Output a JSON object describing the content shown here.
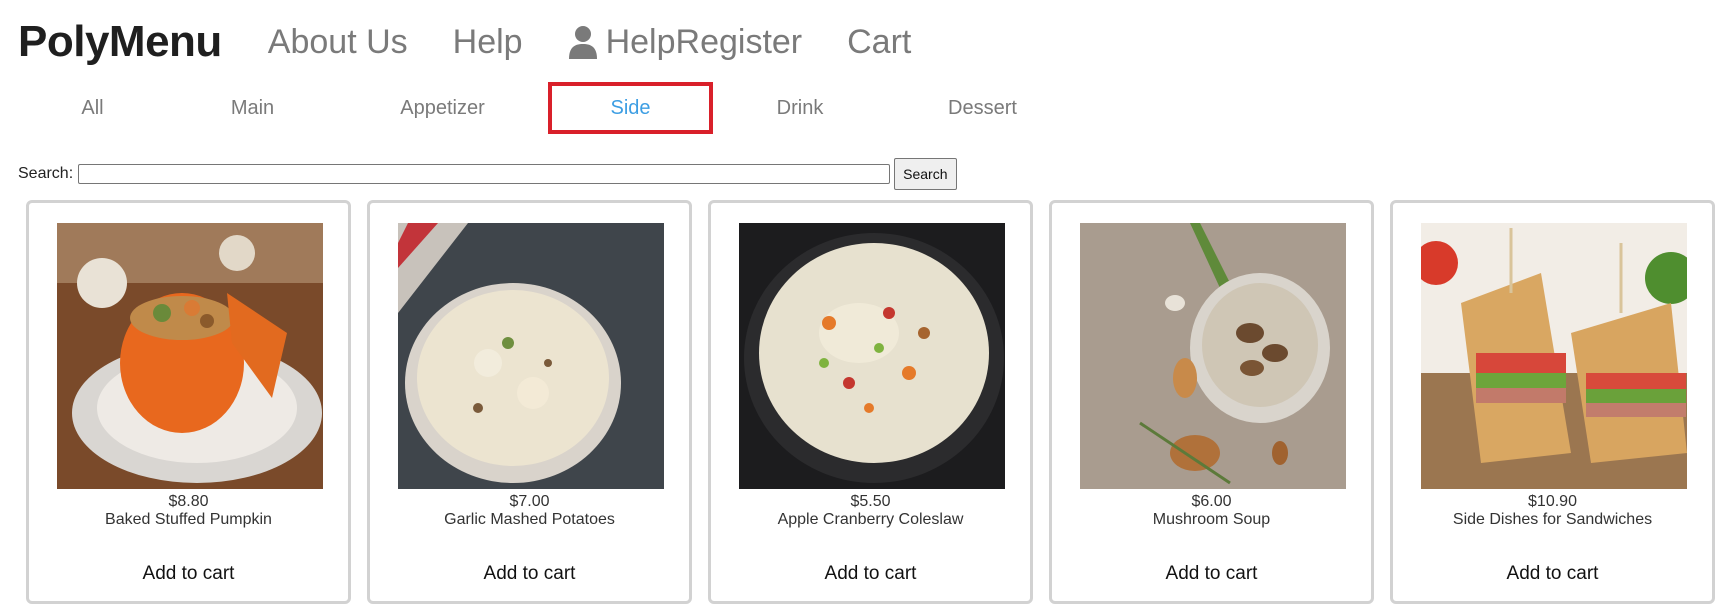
{
  "header": {
    "brand": "PolyMenu",
    "nav": [
      "About Us",
      "Help",
      "HelpRegister",
      "Cart"
    ],
    "user_icon": "user-icon"
  },
  "tabs": [
    {
      "label": "All",
      "active": false
    },
    {
      "label": "Main",
      "active": false
    },
    {
      "label": "Appetizer",
      "active": false
    },
    {
      "label": "Side",
      "active": true
    },
    {
      "label": "Drink",
      "active": false
    },
    {
      "label": "Dessert",
      "active": false
    }
  ],
  "colors": {
    "active_tab_text": "#3d9ee3",
    "active_tab_border": "#d9202a",
    "nav_text": "#7a7a7a"
  },
  "search": {
    "label": "Search:",
    "value": "",
    "button": "Search"
  },
  "products": [
    {
      "price": "$8.80",
      "name": "Baked Stuffed Pumpkin",
      "action": "Add to cart",
      "image": "pumpkin-photo"
    },
    {
      "price": "$7.00",
      "name": "Garlic Mashed Potatoes",
      "action": "Add to cart",
      "image": "mashed-potatoes-photo"
    },
    {
      "price": "$5.50",
      "name": "Apple Cranberry Coleslaw",
      "action": "Add to cart",
      "image": "coleslaw-photo"
    },
    {
      "price": "$6.00",
      "name": "Mushroom Soup",
      "action": "Add to cart",
      "image": "mushroom-soup-photo"
    },
    {
      "price": "$10.90",
      "name": "Side Dishes for Sandwiches",
      "action": "Add to cart",
      "image": "sandwich-photo"
    }
  ]
}
